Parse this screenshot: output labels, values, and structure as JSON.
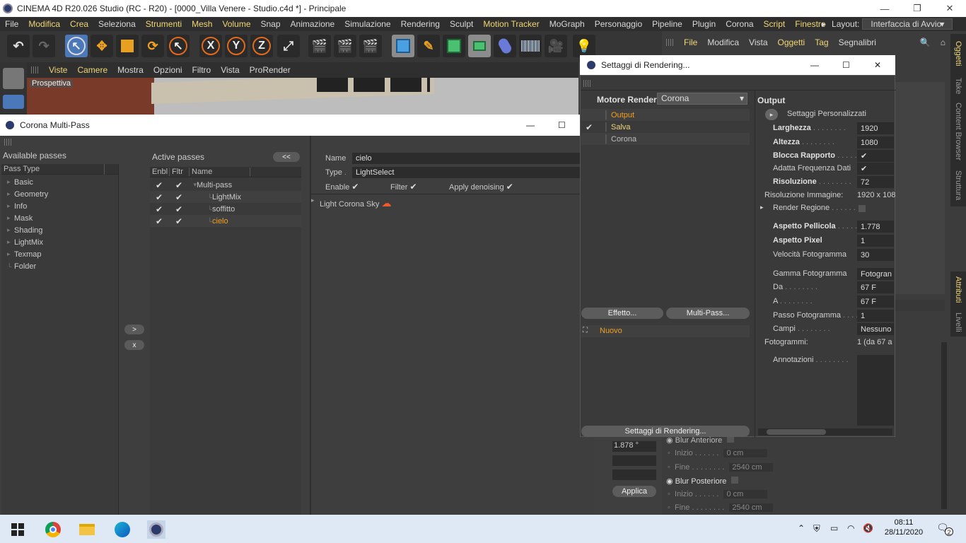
{
  "window": {
    "title": "CINEMA 4D R20.026 Studio (RC - R20) - [0000_Villa Venere - Studio.c4d *] - Principale"
  },
  "menubar": [
    {
      "label": "File",
      "hl": false
    },
    {
      "label": "Modifica",
      "hl": true
    },
    {
      "label": "Crea",
      "hl": true
    },
    {
      "label": "Seleziona",
      "hl": false
    },
    {
      "label": "Strumenti",
      "hl": true
    },
    {
      "label": "Mesh",
      "hl": true
    },
    {
      "label": "Volume",
      "hl": true
    },
    {
      "label": "Snap",
      "hl": false
    },
    {
      "label": "Animazione",
      "hl": false
    },
    {
      "label": "Simulazione",
      "hl": false
    },
    {
      "label": "Rendering",
      "hl": false
    },
    {
      "label": "Sculpt",
      "hl": false
    },
    {
      "label": "Motion Tracker",
      "hl": true
    },
    {
      "label": "MoGraph",
      "hl": false
    },
    {
      "label": "Personaggio",
      "hl": false
    },
    {
      "label": "Pipeline",
      "hl": false
    },
    {
      "label": "Plugin",
      "hl": false
    },
    {
      "label": "Corona",
      "hl": false
    },
    {
      "label": "Script",
      "hl": true
    },
    {
      "label": "Finestre",
      "hl": true
    }
  ],
  "layout": {
    "label": "Layout:",
    "value": "Interfaccia di Avvio"
  },
  "toolbar": {
    "x": "X",
    "y": "Y",
    "z": "Z"
  },
  "objmenu": [
    {
      "label": "File",
      "hl": true
    },
    {
      "label": "Modifica",
      "hl": false
    },
    {
      "label": "Vista",
      "hl": false
    },
    {
      "label": "Oggetti",
      "hl": true
    },
    {
      "label": "Tag",
      "hl": true
    },
    {
      "label": "Segnalibri",
      "hl": false
    }
  ],
  "vtabs": {
    "oggetti": "Oggetti",
    "take": "Take",
    "content": "Content Browser",
    "struttura": "Struttura",
    "attributi": "Attributi",
    "livelli": "Livelli"
  },
  "viewbar": [
    {
      "label": "Viste",
      "hl": true
    },
    {
      "label": "Camere",
      "hl": true
    },
    {
      "label": "Mostra",
      "hl": false
    },
    {
      "label": "Opzioni",
      "hl": false
    },
    {
      "label": "Filtro",
      "hl": false
    },
    {
      "label": "Vista",
      "hl": false
    },
    {
      "label": "ProRender",
      "hl": false
    }
  ],
  "viewport": {
    "label": "Prospettiva"
  },
  "multipass": {
    "title": "Corona Multi-Pass",
    "available_header": "Available passes",
    "pass_type_header": "Pass Type",
    "available": [
      "Basic",
      "Geometry",
      "Info",
      "Mask",
      "Shading",
      "LightMix",
      "Texmap",
      "Folder"
    ],
    "add_btn": ">",
    "remove_btn": "x",
    "active_header": "Active passes",
    "collapse_btn": "<<",
    "cols": {
      "enbl": "Enbl",
      "fltr": "Fltr",
      "name": "Name"
    },
    "active": [
      {
        "name": "Multi-pass",
        "selected": false
      },
      {
        "name": "LightMix",
        "selected": false
      },
      {
        "name": "soffitto",
        "selected": false
      },
      {
        "name": "cielo",
        "selected": true
      }
    ],
    "props": {
      "name_label": "Name",
      "name_value": "cielo",
      "type_label": "Type",
      "type_value": "LightSelect",
      "enable_label": "Enable",
      "filter_label": "Filter",
      "denoise_label": "Apply denoising",
      "light_item": "Light Corona Sky"
    }
  },
  "render": {
    "title": "Settaggi di Rendering...",
    "engine_label": "Motore Render",
    "engine_value": "Corona",
    "tree": [
      {
        "label": "Output",
        "color": "#f0a020",
        "checked": false
      },
      {
        "label": "Salva",
        "color": "#f1d675",
        "checked": true
      },
      {
        "label": "Corona",
        "color": "#bdbdbd",
        "checked": false
      }
    ],
    "effect_btn": "Effetto...",
    "multipass_btn": "Multi-Pass...",
    "nuovo": "Nuovo",
    "bottom_btn": "Settaggi di Rendering...",
    "output_header": "Output",
    "preset": "Settaggi Personalizzati",
    "fields": [
      {
        "label": "Larghezza",
        "bold": true,
        "value": "1920"
      },
      {
        "label": "Altezza",
        "bold": true,
        "value": "1080"
      },
      {
        "label": "Blocca Rapporto",
        "bold": true,
        "value": "✔"
      },
      {
        "label": "Adatta Frequenza Dati",
        "bold": false,
        "value": "✔"
      },
      {
        "label": "Risoluzione",
        "bold": true,
        "value": "72"
      },
      {
        "label": "Risoluzione Immagine:",
        "bold": false,
        "value": "1920 x 108"
      },
      {
        "label": "Render Regione",
        "bold": false,
        "value": ""
      },
      {
        "label": "Aspetto Pellicola",
        "bold": true,
        "value": "1.778"
      },
      {
        "label": "Aspetto Pixel",
        "bold": true,
        "value": "1"
      },
      {
        "label": "Velocità Fotogramma",
        "bold": false,
        "value": "30"
      },
      {
        "label": "Gamma Fotogramma",
        "bold": false,
        "value": "Fotogran"
      },
      {
        "label": "Da",
        "bold": false,
        "value": "67 F"
      },
      {
        "label": "A",
        "bold": false,
        "value": "67 F"
      },
      {
        "label": "Passo Fotogramma",
        "bold": false,
        "value": "1"
      },
      {
        "label": "Campi",
        "bold": false,
        "value": "Nessuno"
      },
      {
        "label": "Fotogrammi:",
        "bold": false,
        "value": "1 (da 67 a"
      },
      {
        "label": "Annotazioni",
        "bold": false,
        "value": ""
      }
    ]
  },
  "attr_bg": {
    "val_1": "1.878 °",
    "applica": "Applica",
    "blur_ant": "Blur Anteriore",
    "inizio": "Inizio",
    "fine": "Fine",
    "blur_post": "Blur Posteriore",
    "zero": "0 cm",
    "far": "2540 cm"
  },
  "taskbar": {
    "time": "08:11",
    "date": "28/11/2020",
    "notif": "2"
  }
}
